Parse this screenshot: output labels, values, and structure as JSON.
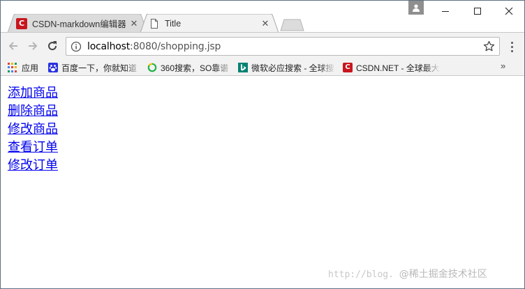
{
  "tabs": [
    {
      "title": "CSDN-markdown编辑器",
      "icon": "csdn-logo-icon",
      "active": false
    },
    {
      "title": "Title",
      "icon": "page-icon",
      "active": true
    }
  ],
  "toolbar": {
    "url_host": "localhost",
    "url_path": ":8080/shopping.jsp"
  },
  "bookmarks": {
    "apps_label": "应用",
    "items": [
      {
        "label": "百度一下，你就知道",
        "icon": "baidu-paw-icon"
      },
      {
        "label": "360搜索，SO靠谱",
        "icon": "360-search-icon"
      },
      {
        "label": "微软必应搜索 - 全球搜",
        "icon": "bing-icon"
      },
      {
        "label": "CSDN.NET - 全球最大",
        "icon": "csdn-logo-icon"
      }
    ],
    "more": "»"
  },
  "links": [
    "添加商品",
    "删除商品",
    "修改商品",
    "查看订单",
    "修改订单"
  ],
  "watermark": {
    "text": "http://blog.",
    "brand": "@稀土掘金技术社区"
  },
  "colors": {
    "link": "#0000ee",
    "csdn_red": "#c8161e",
    "toolbar_bg": "#f2f2f2"
  }
}
